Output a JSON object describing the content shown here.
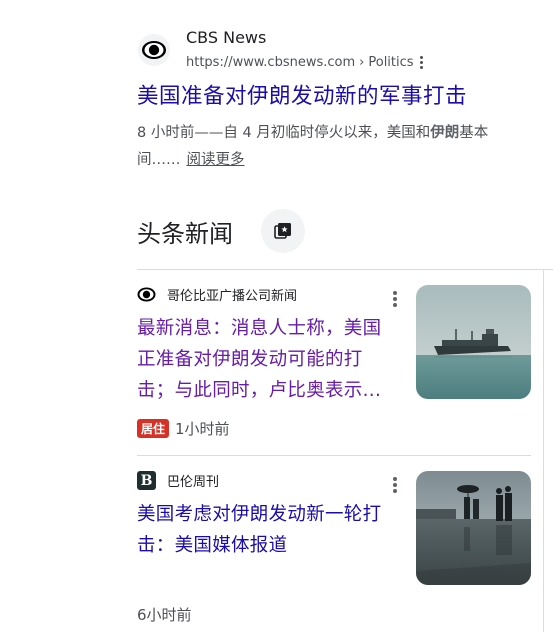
{
  "result": {
    "site_name": "CBS News",
    "url": "https://www.cbsnews.com",
    "breadcrumb_separator": "›",
    "breadcrumb": "Politics",
    "title": "美国准备对伊朗发动新的军事打击",
    "snippet_prefix": "8 小时前——自 4 月初临时停火以来，美国和",
    "snippet_bold": "伊朗",
    "snippet_suffix": "基本",
    "snippet_line2": "间……",
    "read_more": "阅读更多"
  },
  "top_stories": {
    "heading": "头条新闻",
    "stories": [
      {
        "source": "哥伦比亚广播公司新闻",
        "headline": "最新消息：消息人士称，美国正准备对伊朗发动可能的打击；与此同时，卢比奥表示...",
        "badge": "居住",
        "time": "1小时前"
      },
      {
        "source": "巴伦周刊",
        "source_icon_letter": "B",
        "headline": "美国考虑对伊朗发动新一轮打击：美国媒体报道",
        "time": "6小时前"
      }
    ]
  },
  "colors": {
    "link": "#1a0dab",
    "visited": "#681da8",
    "live_badge": "#d93025"
  }
}
